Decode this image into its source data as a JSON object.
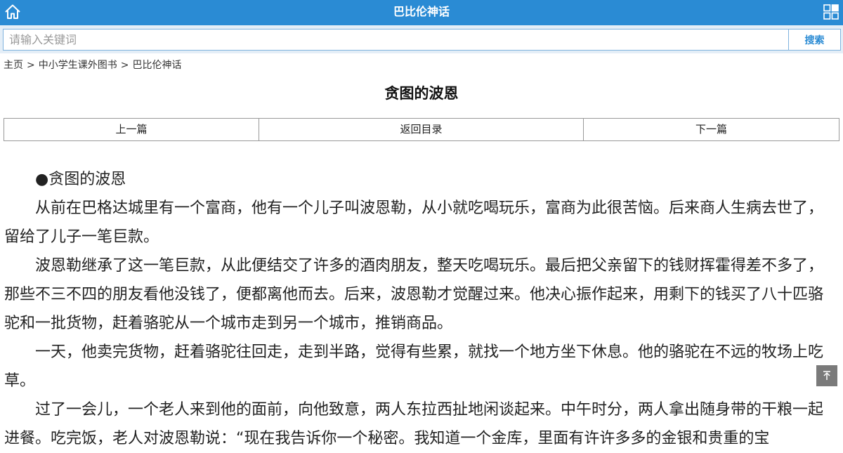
{
  "header": {
    "title": "巴比伦神话",
    "home_icon": "home-icon",
    "menu_icon": "grid-icon",
    "bg_color": "#2a8bd4"
  },
  "search": {
    "placeholder": "请输入关键词",
    "value": "",
    "button_label": "搜索"
  },
  "breadcrumb": {
    "items": [
      "主页",
      "中小学生课外图书",
      "巴比伦神话"
    ],
    "separator": ">"
  },
  "article": {
    "title": "贪图的波恩",
    "paragraphs": [
      "●贪图的波恩",
      "从前在巴格达城里有一个富商，他有一个儿子叫波恩勒，从小就吃喝玩乐，富商为此很苦恼。后来商人生病去世了，留给了儿子一笔巨款。",
      "波恩勒继承了这一笔巨款，从此便结交了许多的酒肉朋友，整天吃喝玩乐。最后把父亲留下的钱财挥霍得差不多了，那些不三不四的朋友看他没钱了，便都离他而去。后来，波恩勒才觉醒过来。他决心振作起来，用剩下的钱买了八十匹骆驼和一批货物，赶着骆驼从一个城市走到另一个城市，推销商品。",
      "一天，他卖完货物，赶着骆驼往回走，走到半路，觉得有些累，就找一个地方坐下休息。他的骆驼在不远的牧场上吃草。",
      "过了一会儿，一个老人来到他的面前，向他致意，两人东拉西扯地闲谈起来。中午时分，两人拿出随身带的干粮一起进餐。吃完饭，老人对波恩勒说：“现在我告诉你一个秘密。我知道一个金库，里面有许许多多的金银和贵重的宝"
    ]
  },
  "pager": {
    "prev_label": "上一篇",
    "toc_label": "返回目录",
    "next_label": "下一篇"
  },
  "back_to_top": {
    "icon": "arrow-up-to-top-icon"
  }
}
